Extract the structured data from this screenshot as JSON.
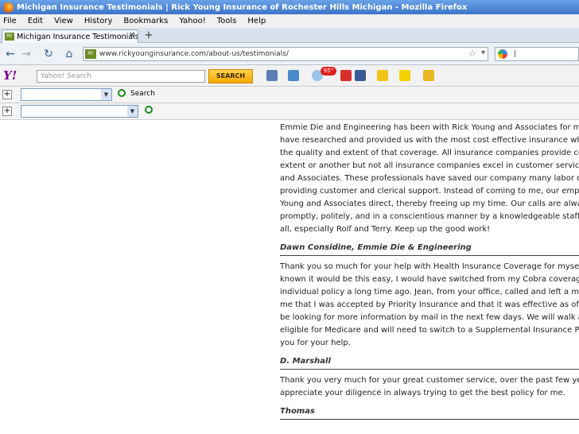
{
  "window": {
    "title": "Michigan Insurance Testimonials | Rick Young Insurance of Rochester Hills Michigan - Mozilla Firefox"
  },
  "menu": [
    "File",
    "Edit",
    "View",
    "History",
    "Bookmarks",
    "Yahoo!",
    "Tools",
    "Help"
  ],
  "tab": {
    "label": "Michigan Insurance Testimonials | Rick Yo...",
    "favicon_text": "RY"
  },
  "nav": {
    "url": "www.rickyounginsurance.com/about-us/testimonials/",
    "favicon_text": "RY"
  },
  "yahoo": {
    "logo": "Y!",
    "search_placeholder": "Yahoo! Search",
    "search_button": "SEARCH",
    "weather_badge": "95°"
  },
  "toolbar2": {
    "search_label": "Search"
  },
  "testimonials": [
    {
      "lines": [
        "Emmie Die and Engineering has been with Rick Young and Associates for many y",
        "have researched and provided us with the most cost effective insurance while ma",
        "the quality and extent of that coverage. All insurance companies provide coverag",
        "extent or another but not all insurance companies excel in customer service like R",
        "and Associates. These professionals have saved our company many labor dollars",
        "providing customer and clerical support. Instead of coming to me, our employee",
        "Young and Associates direct, thereby freeing up my time. Our calls are always ha",
        "promptly, politely, and in a conscientious manner by a knowledgeable staff. Thank",
        "all, especially Rolf and Terry. Keep up the good work!"
      ],
      "signature": "Dawn Considine, Emmie Die & Engineering"
    },
    {
      "lines": [
        "Thank you so much for your help with Health Insurance Coverage for myself. If I",
        "known it would be this easy, I would have switched from my Cobra coverage to",
        "individual policy a long time ago. Jean, from your office, called and left a message",
        "me that I was accepted by Priority Insurance and that it was effective as of May",
        "be looking for more information by mail in the next few days. We will walk again w",
        "eligible for Medicare and will need to switch to a Supplemental Insurance Policy. Ag",
        "you for your help."
      ],
      "signature": "D. Marshall"
    },
    {
      "lines": [
        "Thank you very much for your great customer service, over the past few years,",
        "appreciate your diligence in always trying to get the best policy for me."
      ],
      "signature": "Thomas"
    }
  ],
  "colors": {
    "titlebar": "#3d74c9",
    "yahoo_purple": "#7b0099",
    "search_button": "#f5a700"
  }
}
